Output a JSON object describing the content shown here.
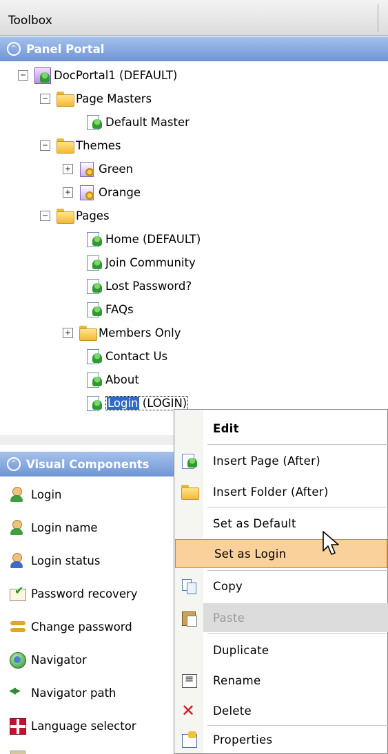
{
  "toolbox": {
    "title": "Toolbox"
  },
  "panel_portal": {
    "title": "Panel Portal",
    "tree": {
      "root": "DocPortal1 (DEFAULT)",
      "page_masters": "Page Masters",
      "default_master": "Default Master",
      "themes": "Themes",
      "theme_green": "Green",
      "theme_orange": "Orange",
      "pages": "Pages",
      "page_home": "Home (DEFAULT)",
      "page_join": "Join Community",
      "page_lost": "Lost Password?",
      "page_faqs": "FAQs",
      "members_only": "Members Only",
      "page_contact": "Contact Us",
      "page_about": "About",
      "page_login_name": "Login",
      "page_login_suffix": " (LOGIN)",
      "expander_minus": "−",
      "expander_plus": "+"
    }
  },
  "visual_components": {
    "title": "Visual Components",
    "items": [
      {
        "label": "Login",
        "icon": "user-green-icon"
      },
      {
        "label": "Login name",
        "icon": "user-green-icon"
      },
      {
        "label": "Login status",
        "icon": "user-blue-icon"
      },
      {
        "label": "Password recovery",
        "icon": "mail-check-icon"
      },
      {
        "label": "Change password",
        "icon": "keys-icon"
      },
      {
        "label": "Navigator",
        "icon": "globe-icon"
      },
      {
        "label": "Navigator path",
        "icon": "arrows-icon"
      },
      {
        "label": "Language selector",
        "icon": "flag-icon"
      }
    ]
  },
  "context_menu": {
    "items": [
      {
        "label": "Edit",
        "icon": ""
      },
      {
        "label": "Insert Page (After)",
        "icon": "page-icon"
      },
      {
        "label": "Insert Folder (After)",
        "icon": "folder-icon"
      },
      {
        "label": "Set as Default",
        "icon": ""
      },
      {
        "label": "Set as Login",
        "icon": ""
      },
      {
        "label": "Copy",
        "icon": "copy-icon"
      },
      {
        "label": "Paste",
        "icon": "paste-icon"
      },
      {
        "label": "Duplicate",
        "icon": ""
      },
      {
        "label": "Rename",
        "icon": "rename-icon"
      },
      {
        "label": "Delete",
        "icon": "delete-icon"
      },
      {
        "label": "Properties",
        "icon": "properties-icon"
      }
    ],
    "highlighted": "Set as Login",
    "disabled": "Paste"
  },
  "colors": {
    "panel_header": "#6e95d4",
    "selection": "#316ac5",
    "menu_highlight": "#fbd19b"
  }
}
